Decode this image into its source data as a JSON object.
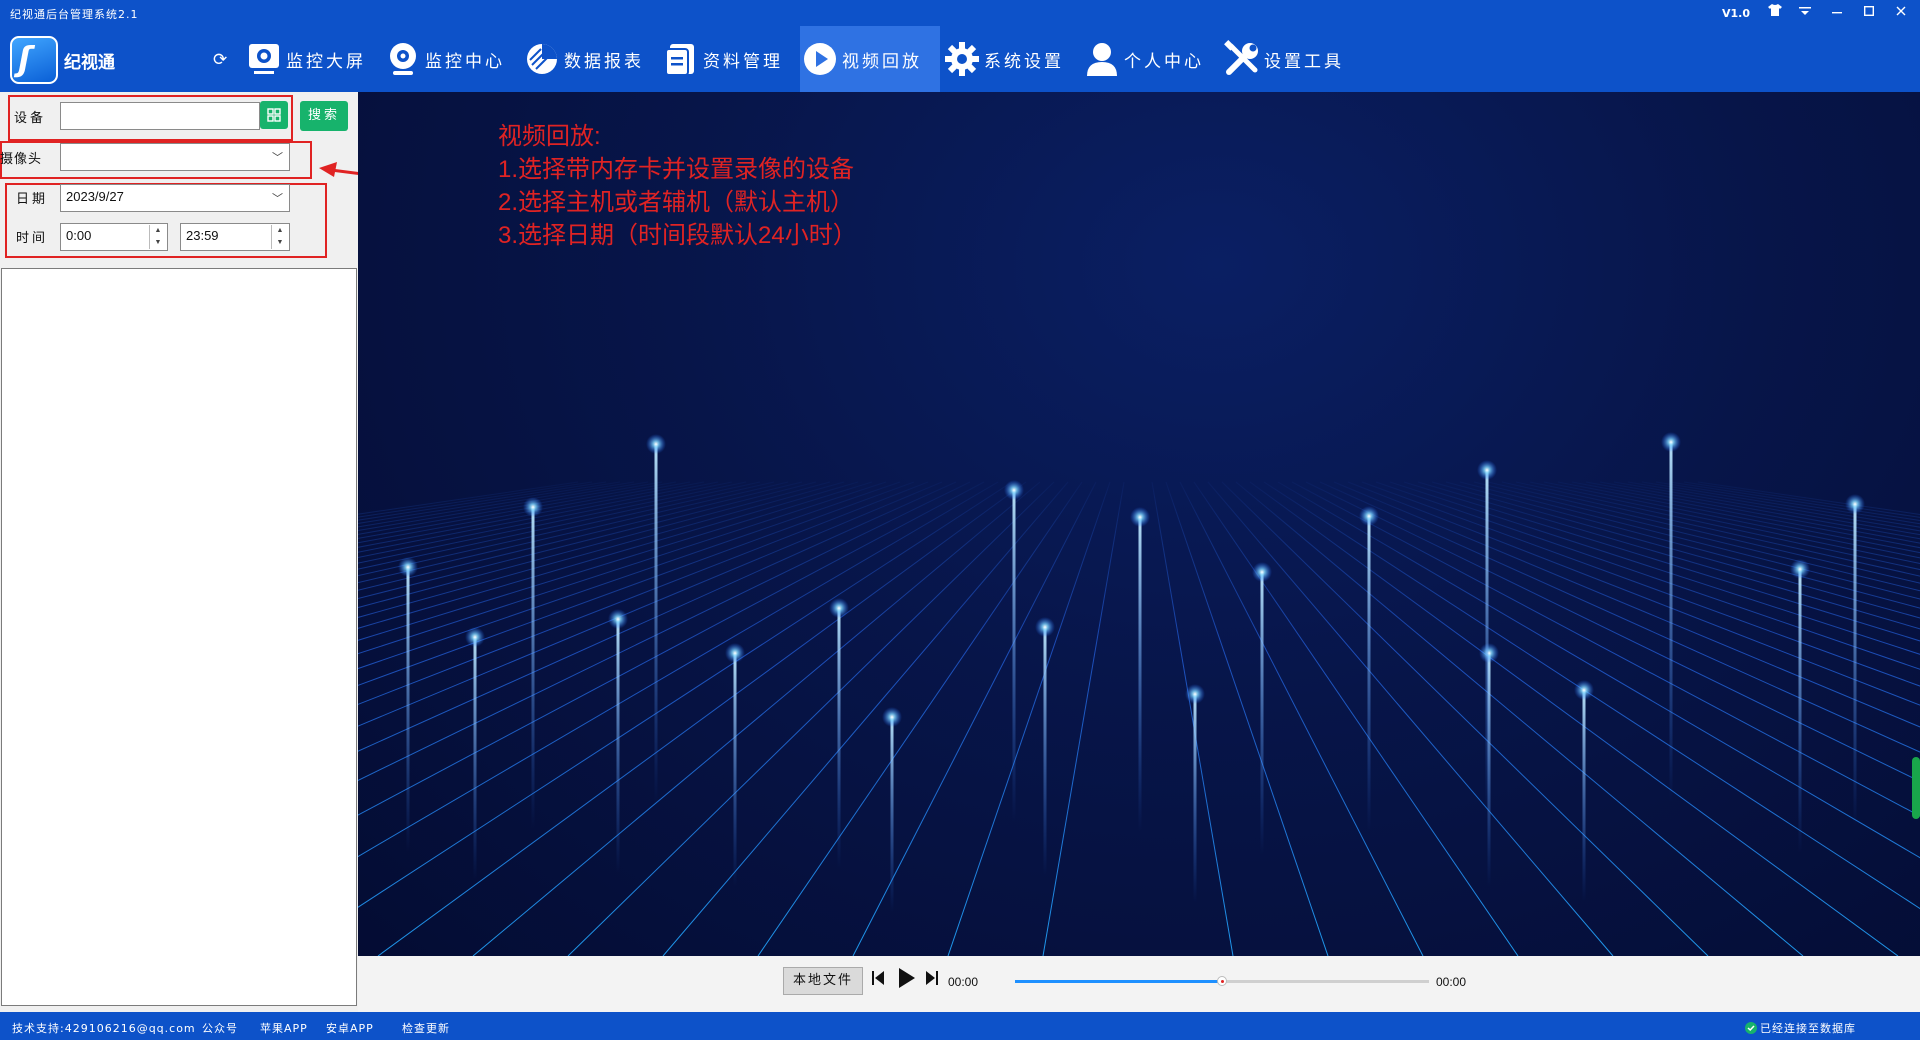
{
  "window": {
    "title": "纪视通后台管理系统2.1",
    "version": "V1.0",
    "controls": [
      "shirt-icon",
      "menu-icon",
      "minimize-icon",
      "maximize-icon",
      "close-icon"
    ]
  },
  "app": {
    "name": "纪视通"
  },
  "nav": {
    "items": [
      {
        "label": "监控大屏",
        "icon": "monitor-screen-icon"
      },
      {
        "label": "监控中心",
        "icon": "camera-icon"
      },
      {
        "label": "数据报表",
        "icon": "pie-chart-icon"
      },
      {
        "label": "资料管理",
        "icon": "document-icon"
      },
      {
        "label": "视频回放",
        "icon": "play-icon",
        "active": true
      },
      {
        "label": "系统设置",
        "icon": "gear-icon"
      },
      {
        "label": "个人中心",
        "icon": "user-icon"
      },
      {
        "label": "设置工具",
        "icon": "tools-icon"
      }
    ]
  },
  "filters": {
    "device_label": "设备",
    "device_value": "",
    "search_label": "搜索",
    "camera_label": "摄像头",
    "camera_value": "",
    "date_label": "日期",
    "date_value": "2023/9/27",
    "time_label": "时间",
    "time_start": "0:00",
    "time_end": "23:59"
  },
  "annotation": {
    "line1": "视频回放:",
    "line2": "1.选择带内存卡并设置录像的设备",
    "line3": "2.选择主机或者辅机（默认主机）",
    "line4": "3.选择日期（时间段默认24小时）"
  },
  "player": {
    "local_file": "本地文件",
    "current_time": "00:00",
    "total_time": "00:00",
    "progress": 0.5
  },
  "status": {
    "support": "技术支持:429106216@qq.com",
    "wechat": "公众号",
    "apple": "苹果APP",
    "android": "安卓APP",
    "update": "检查更新",
    "connection": "已经连接至数据库"
  },
  "colors": {
    "brand": "#0d52c9",
    "accent_green": "#17b36c",
    "annotation_red": "#e02323"
  }
}
